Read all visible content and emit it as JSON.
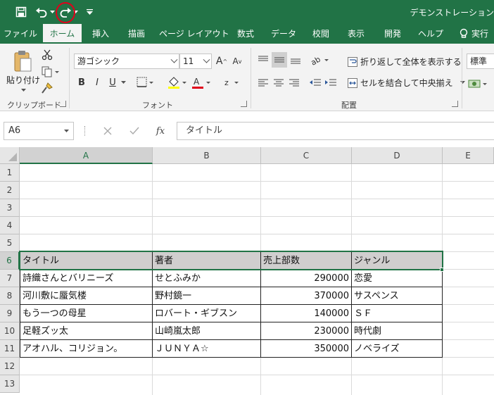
{
  "titlebar": {
    "doc_title": "デモンストレーション"
  },
  "tabs": [
    {
      "label": "ファイル",
      "active": false
    },
    {
      "label": "ホーム",
      "active": true
    },
    {
      "label": "挿入",
      "active": false
    },
    {
      "label": "描画",
      "active": false
    },
    {
      "label": "ページ レイアウト",
      "active": false
    },
    {
      "label": "数式",
      "active": false
    },
    {
      "label": "データ",
      "active": false
    },
    {
      "label": "校閲",
      "active": false
    },
    {
      "label": "表示",
      "active": false
    },
    {
      "label": "開発",
      "active": false
    },
    {
      "label": "ヘルプ",
      "active": false
    },
    {
      "label": "実行",
      "active": false
    }
  ],
  "ribbon": {
    "clipboard": {
      "paste_label": "貼り付け",
      "group_label": "クリップボード"
    },
    "font": {
      "font_name": "游ゴシック",
      "font_size": "11",
      "group_label": "フォント",
      "bold": "B",
      "italic": "I",
      "underline": "U"
    },
    "alignment": {
      "wrap_text": "折り返して全体を表示する",
      "merge_center": "セルを結合して中央揃え",
      "group_label": "配置"
    },
    "number": {
      "format": "標準"
    }
  },
  "formula_bar": {
    "name_box": "A6",
    "fx": "fx",
    "formula": "タイトル"
  },
  "columns": [
    "A",
    "B",
    "C",
    "D",
    "E"
  ],
  "rows": [
    "1",
    "2",
    "3",
    "4",
    "5",
    "6",
    "7",
    "8",
    "9",
    "10",
    "11",
    "12",
    "13"
  ],
  "table": {
    "headers": [
      "タイトル",
      "著者",
      "売上部数",
      "ジャンル"
    ],
    "rows": [
      [
        "詩織さんとバリニーズ",
        "せとふみか",
        "290000",
        "恋愛"
      ],
      [
        "河川敷に蜃気楼",
        "野村鏡一",
        "370000",
        "サスペンス"
      ],
      [
        "もう一つの母星",
        "ロバート・ギブスン",
        "140000",
        "ＳＦ"
      ],
      [
        "足軽ズッ太",
        "山崎嵐太郎",
        "230000",
        "時代劇"
      ],
      [
        "アオハル、コリジョン。",
        "ＪＵＮＹＡ☆",
        "350000",
        "ノベライズ"
      ]
    ]
  },
  "colors": {
    "excel_green": "#217346",
    "header_fill": "#d0cece",
    "highlight_red": "#e0001b"
  }
}
